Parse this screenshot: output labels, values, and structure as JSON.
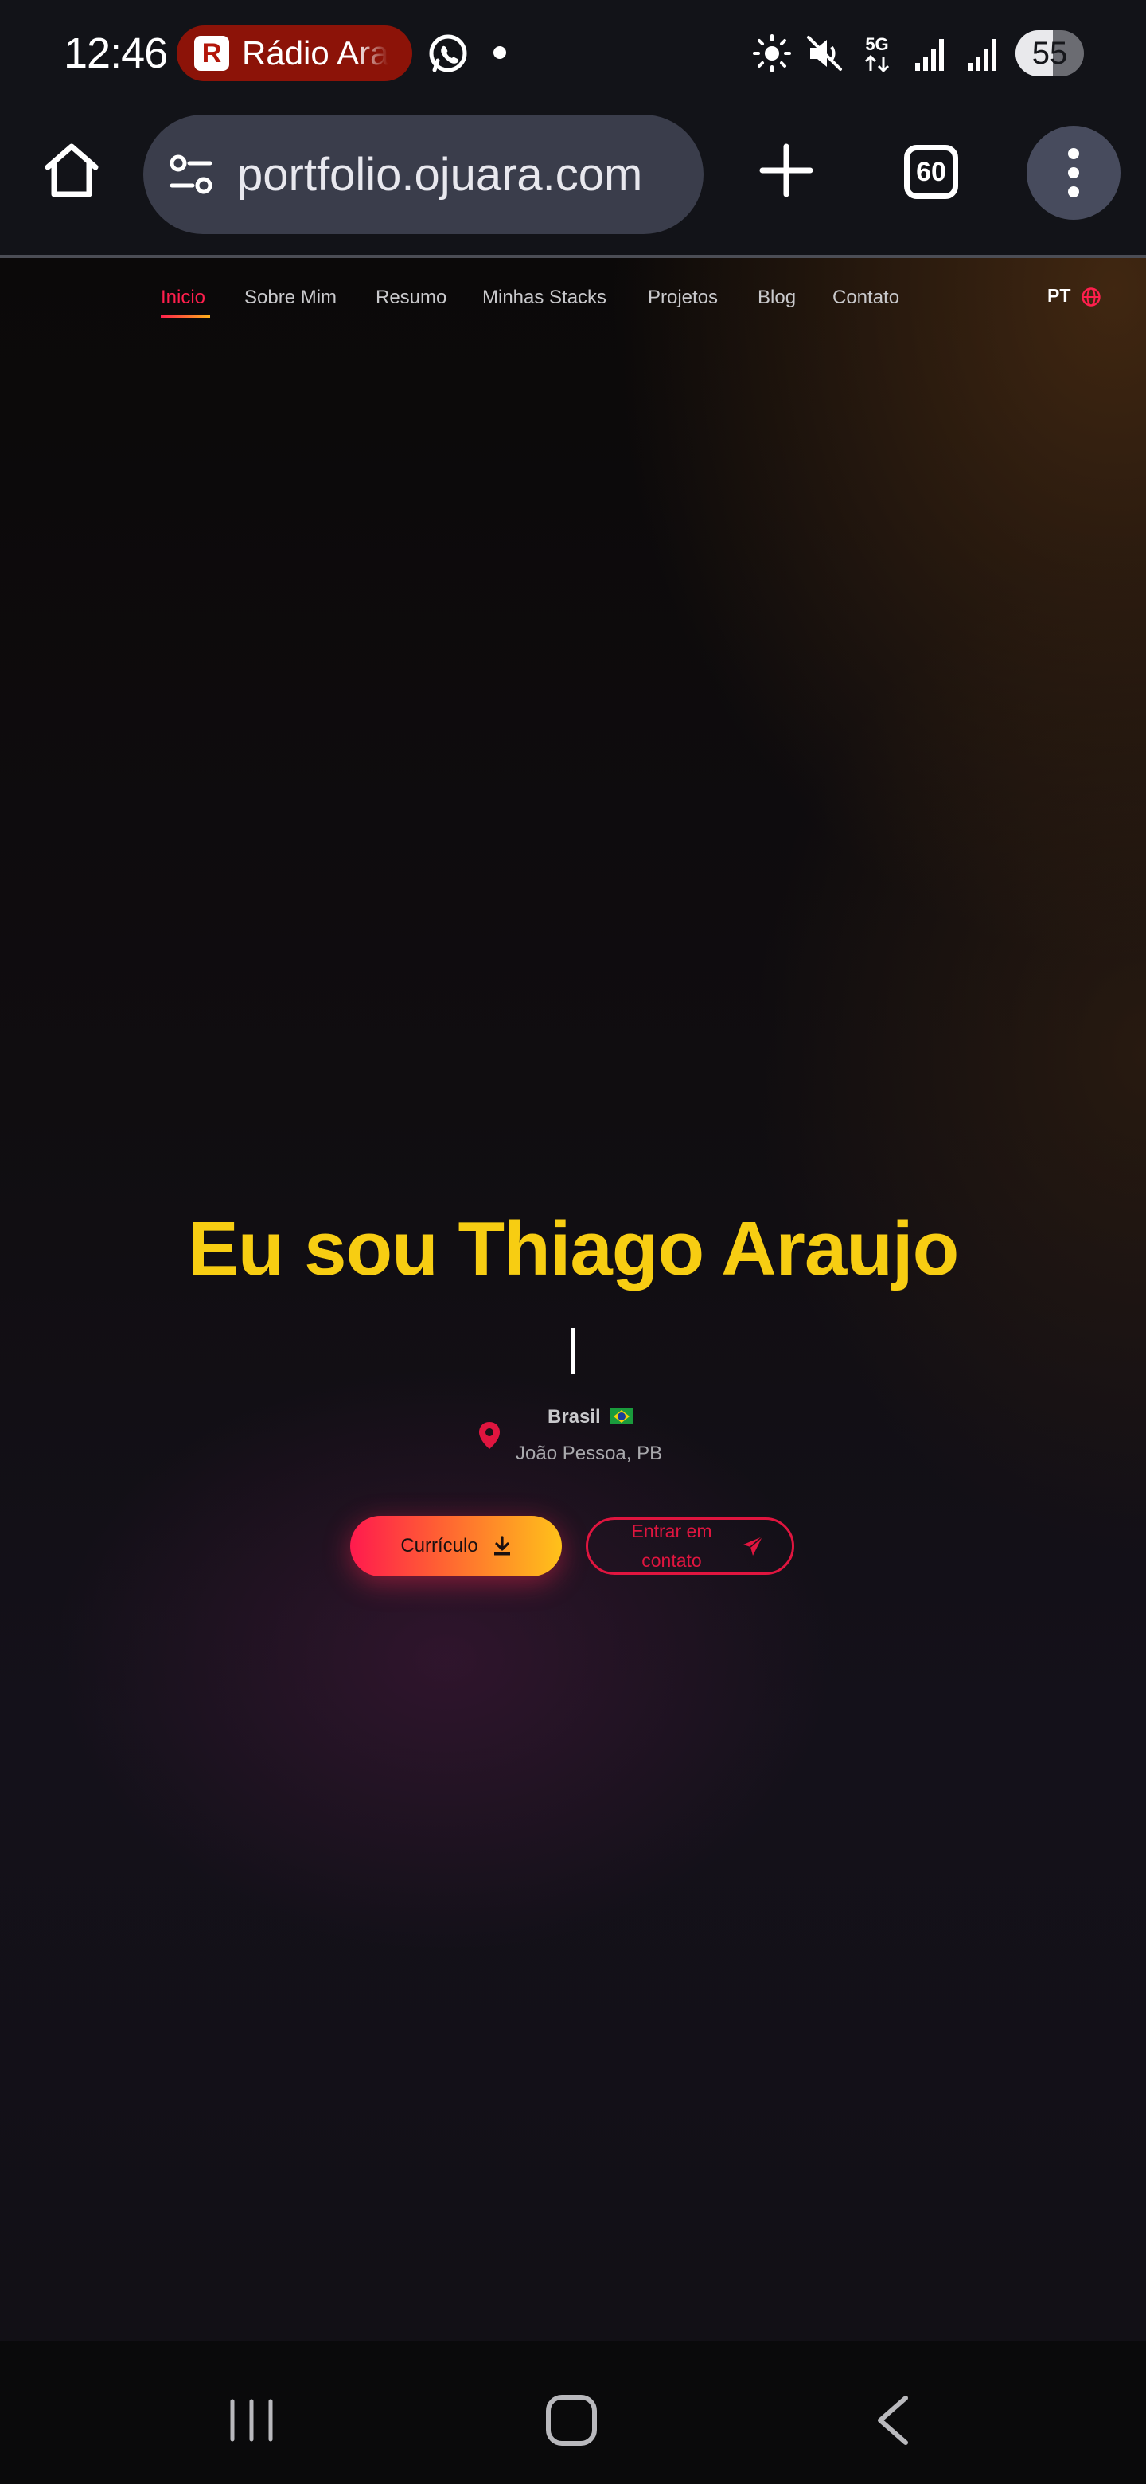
{
  "status_bar": {
    "time": "12:46",
    "notification_app": "Rádio Ara",
    "network_type": "5G",
    "battery_level": "55",
    "battery_fraction": 0.55
  },
  "browser": {
    "url": "portfolio.ojuara.com",
    "tab_count": "60"
  },
  "site": {
    "nav_items": [
      "Inicio",
      "Sobre Mim",
      "Resumo",
      "Minhas Stacks",
      "Projetos",
      "Blog",
      "Contato"
    ],
    "active_nav": "Inicio",
    "language": "PT",
    "hero_title": "Eu sou Thiago Araujo",
    "country": "Brasil",
    "city": "João Pessoa, PB",
    "resume_button": "Currículo",
    "contact_button": "Entrar em contato"
  },
  "colors": {
    "accent_red": "#ff1f4d",
    "accent_yellow": "#f7cd12",
    "gradient_end": "#ffc21a"
  },
  "icons": [
    "home-icon",
    "tune-icon",
    "plus-icon",
    "tabs-icon",
    "more-vert-icon",
    "location-pin-icon",
    "download-icon",
    "send-icon",
    "globe-icon"
  ]
}
